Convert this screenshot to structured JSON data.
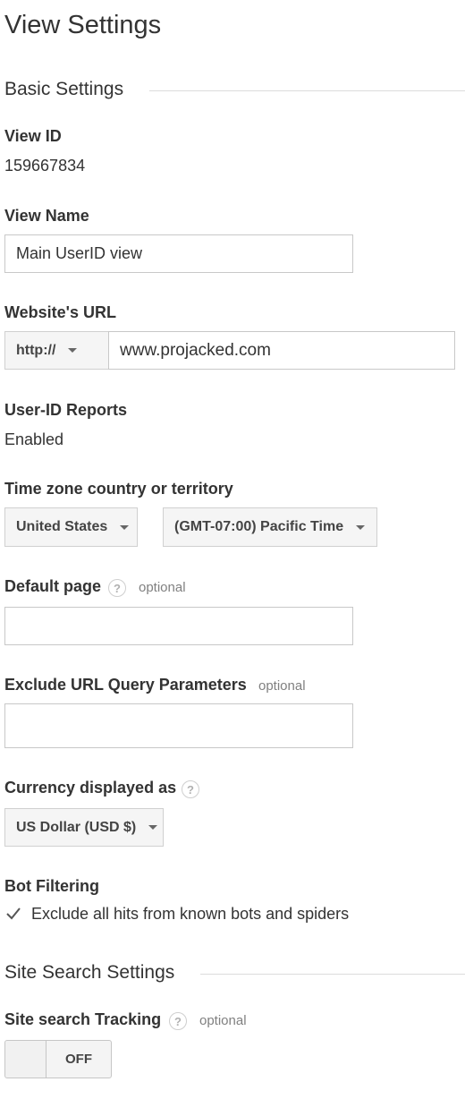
{
  "page": {
    "title": "View Settings"
  },
  "basic_settings": {
    "title": "Basic Settings",
    "view_id": {
      "label": "View ID",
      "value": "159667834"
    },
    "view_name": {
      "label": "View Name",
      "value": "Main UserID view"
    },
    "website_url": {
      "label": "Website's URL",
      "protocol": "http://",
      "value": "www.projacked.com"
    },
    "user_id_reports": {
      "label": "User-ID Reports",
      "value": "Enabled"
    },
    "time_zone": {
      "label": "Time zone country or territory",
      "country": "United States",
      "zone": "(GMT-07:00) Pacific Time"
    },
    "default_page": {
      "label": "Default page",
      "help": "?",
      "optional": "optional",
      "value": ""
    },
    "exclude_params": {
      "label": "Exclude URL Query Parameters",
      "optional": "optional",
      "value": ""
    },
    "currency": {
      "label": "Currency displayed as",
      "help": "?",
      "value": "US Dollar (USD $)"
    },
    "bot_filtering": {
      "label": "Bot Filtering",
      "checkbox_label": "Exclude all hits from known bots and spiders",
      "checked": true
    }
  },
  "site_search": {
    "title": "Site Search Settings",
    "tracking": {
      "label": "Site search Tracking",
      "help": "?",
      "optional": "optional",
      "toggle_state": "OFF"
    }
  },
  "colors": {
    "text": "#333333",
    "muted": "#808080",
    "border": "#c8c8c8",
    "dropdown_bg": "#f5f5f5"
  },
  "icons": [
    "caret-down-icon",
    "help-icon",
    "checkmark-icon",
    "resize-grip-icon"
  ]
}
